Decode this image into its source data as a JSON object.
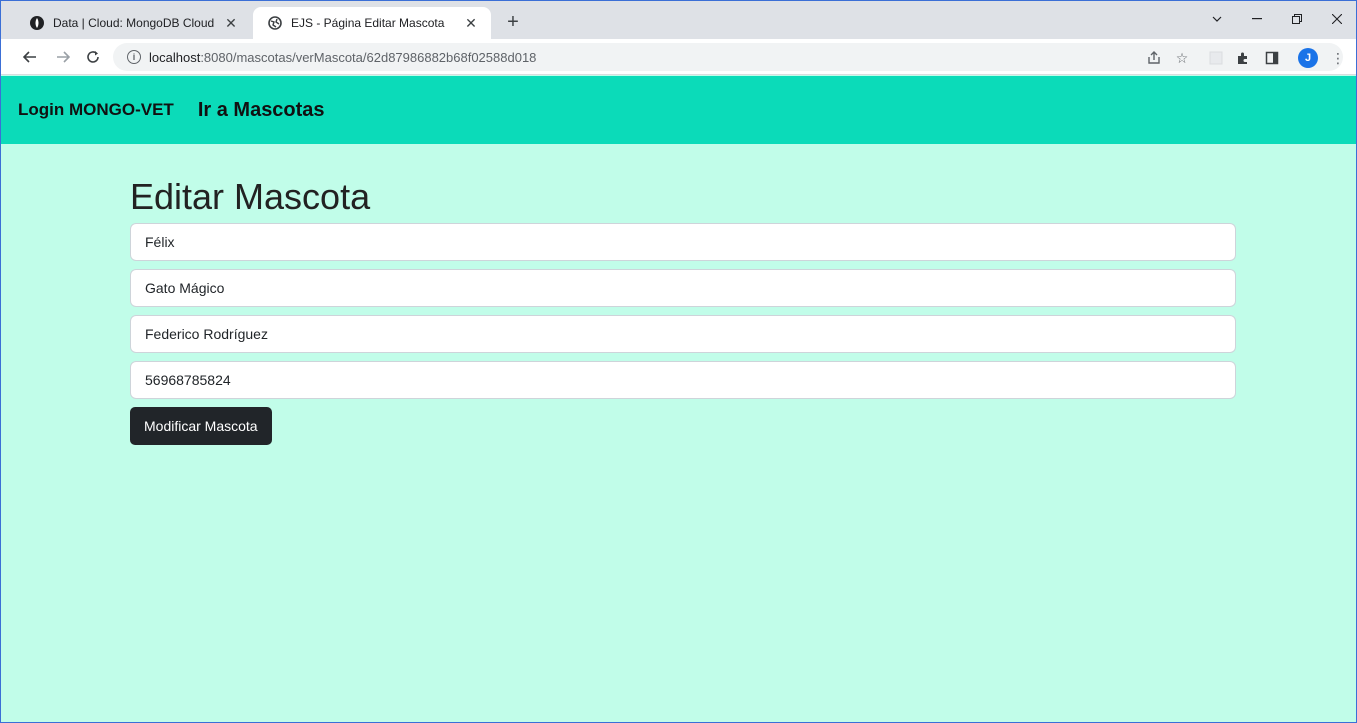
{
  "browser": {
    "tabs": [
      {
        "title": "Data | Cloud: MongoDB Cloud",
        "favicon": "mongodb-leaf-icon"
      },
      {
        "title": "EJS - Página Editar Mascota",
        "favicon": "globe-icon"
      }
    ],
    "new_tab": "+",
    "address": {
      "host": "localhost",
      "rest": ":8080/mascotas/verMascota/62d87986882b68f02588d018"
    },
    "profile_initial": "J"
  },
  "navbar": {
    "brand": "Login MONGO-VET",
    "link": "Ir a Mascotas",
    "color": "#0bdbb9"
  },
  "form": {
    "heading": "Editar Mascota",
    "fields": [
      {
        "value": "Félix"
      },
      {
        "value": "Gato Mágico"
      },
      {
        "value": "Federico Rodríguez"
      },
      {
        "value": "56968785824"
      }
    ],
    "submit_label": "Modificar Mascota"
  },
  "colors": {
    "page_background": "#c1fde9",
    "button": "#212529"
  }
}
